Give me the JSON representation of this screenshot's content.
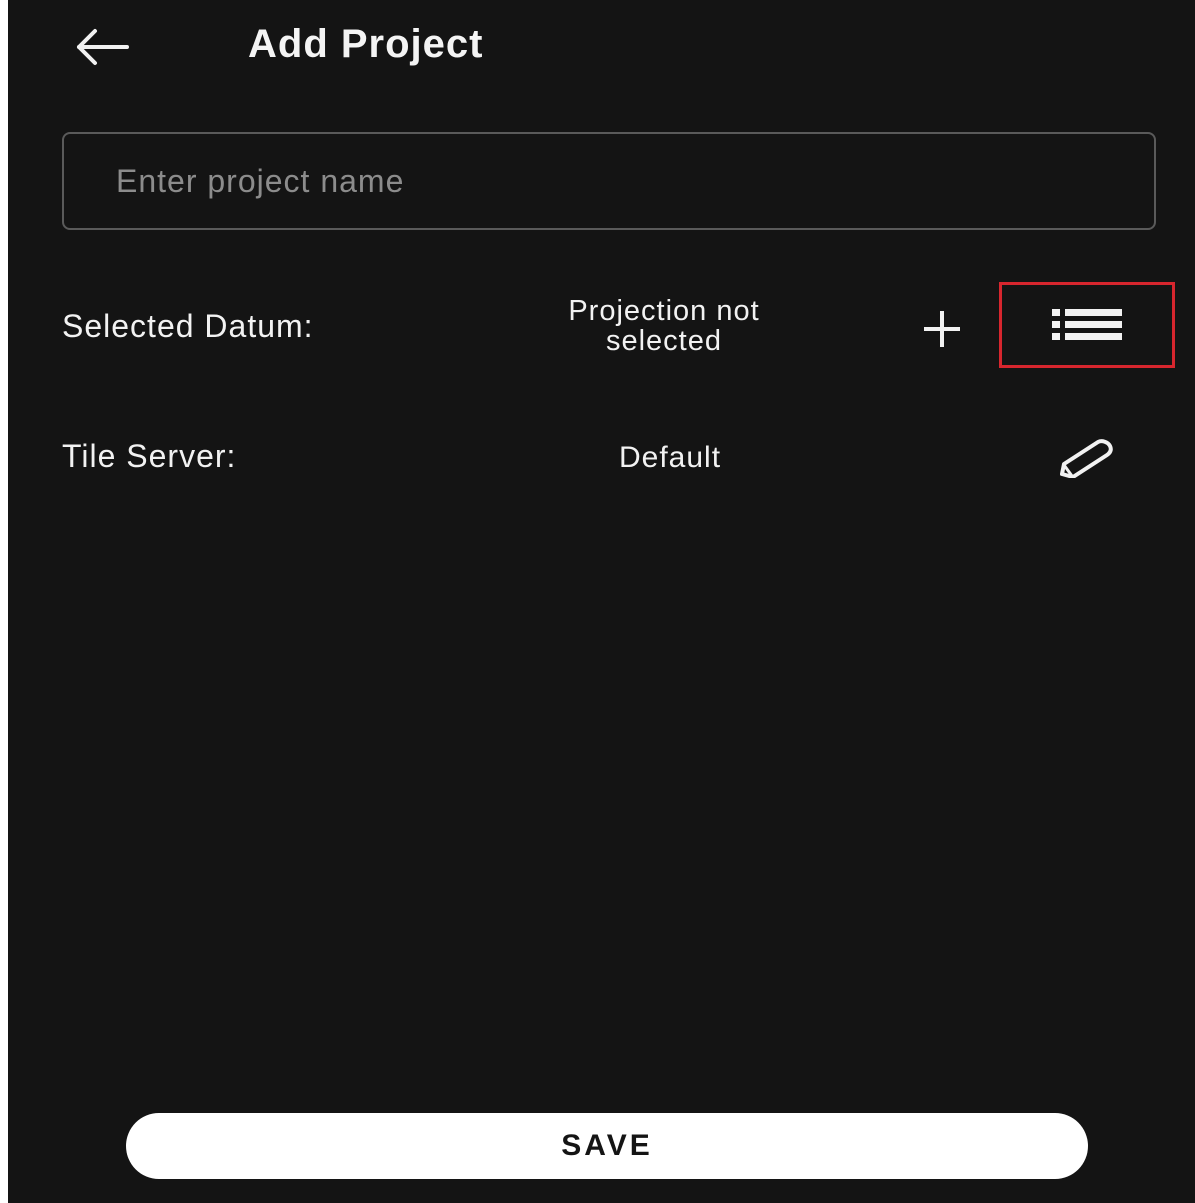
{
  "header": {
    "title": "Add Project",
    "back_icon": "arrow-left-icon"
  },
  "project_name_field": {
    "value": "",
    "placeholder": "Enter project name"
  },
  "datum": {
    "label": "Selected Datum:",
    "value_line1": "Projection not",
    "value_line2": "selected",
    "add_icon": "plus-icon",
    "list_icon": "list-icon",
    "highlight_color": "#d7262e"
  },
  "tile_server": {
    "label": "Tile Server:",
    "value": "Default",
    "edit_icon": "pencil-icon"
  },
  "footer": {
    "save_label": "SAVE"
  },
  "theme": {
    "background": "#141414",
    "foreground": "#f2f2f2",
    "button_background": "#ffffff"
  }
}
